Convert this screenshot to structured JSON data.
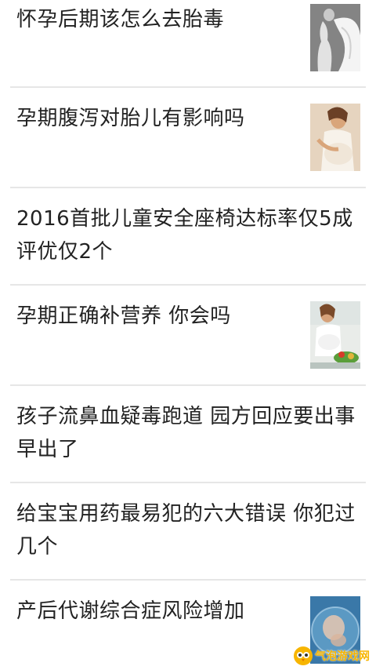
{
  "articles": [
    {
      "title": "怀孕后期该怎么去胎毒",
      "thumbnail": "pregnant-woman-white-cloth"
    },
    {
      "title": "孕期腹泻对胎儿有影响吗",
      "thumbnail": "pregnant-woman-white-dress"
    },
    {
      "title": "2016首批儿童安全座椅达标率仅5成 评优仅2个",
      "thumbnail": ""
    },
    {
      "title": "孕期正确补营养 你会吗",
      "thumbnail": "pregnant-woman-vegetables"
    },
    {
      "title": "孩子流鼻血疑毒跑道 园方回应要出事早出了",
      "thumbnail": ""
    },
    {
      "title": "给宝宝用药最易犯的六大错误 你犯过几个",
      "thumbnail": ""
    },
    {
      "title": "产后代谢综合症风险增加",
      "thumbnail": "baby-in-womb"
    }
  ],
  "watermark": {
    "text": "气泡游戏网",
    "logo_color": "#f7b500"
  }
}
